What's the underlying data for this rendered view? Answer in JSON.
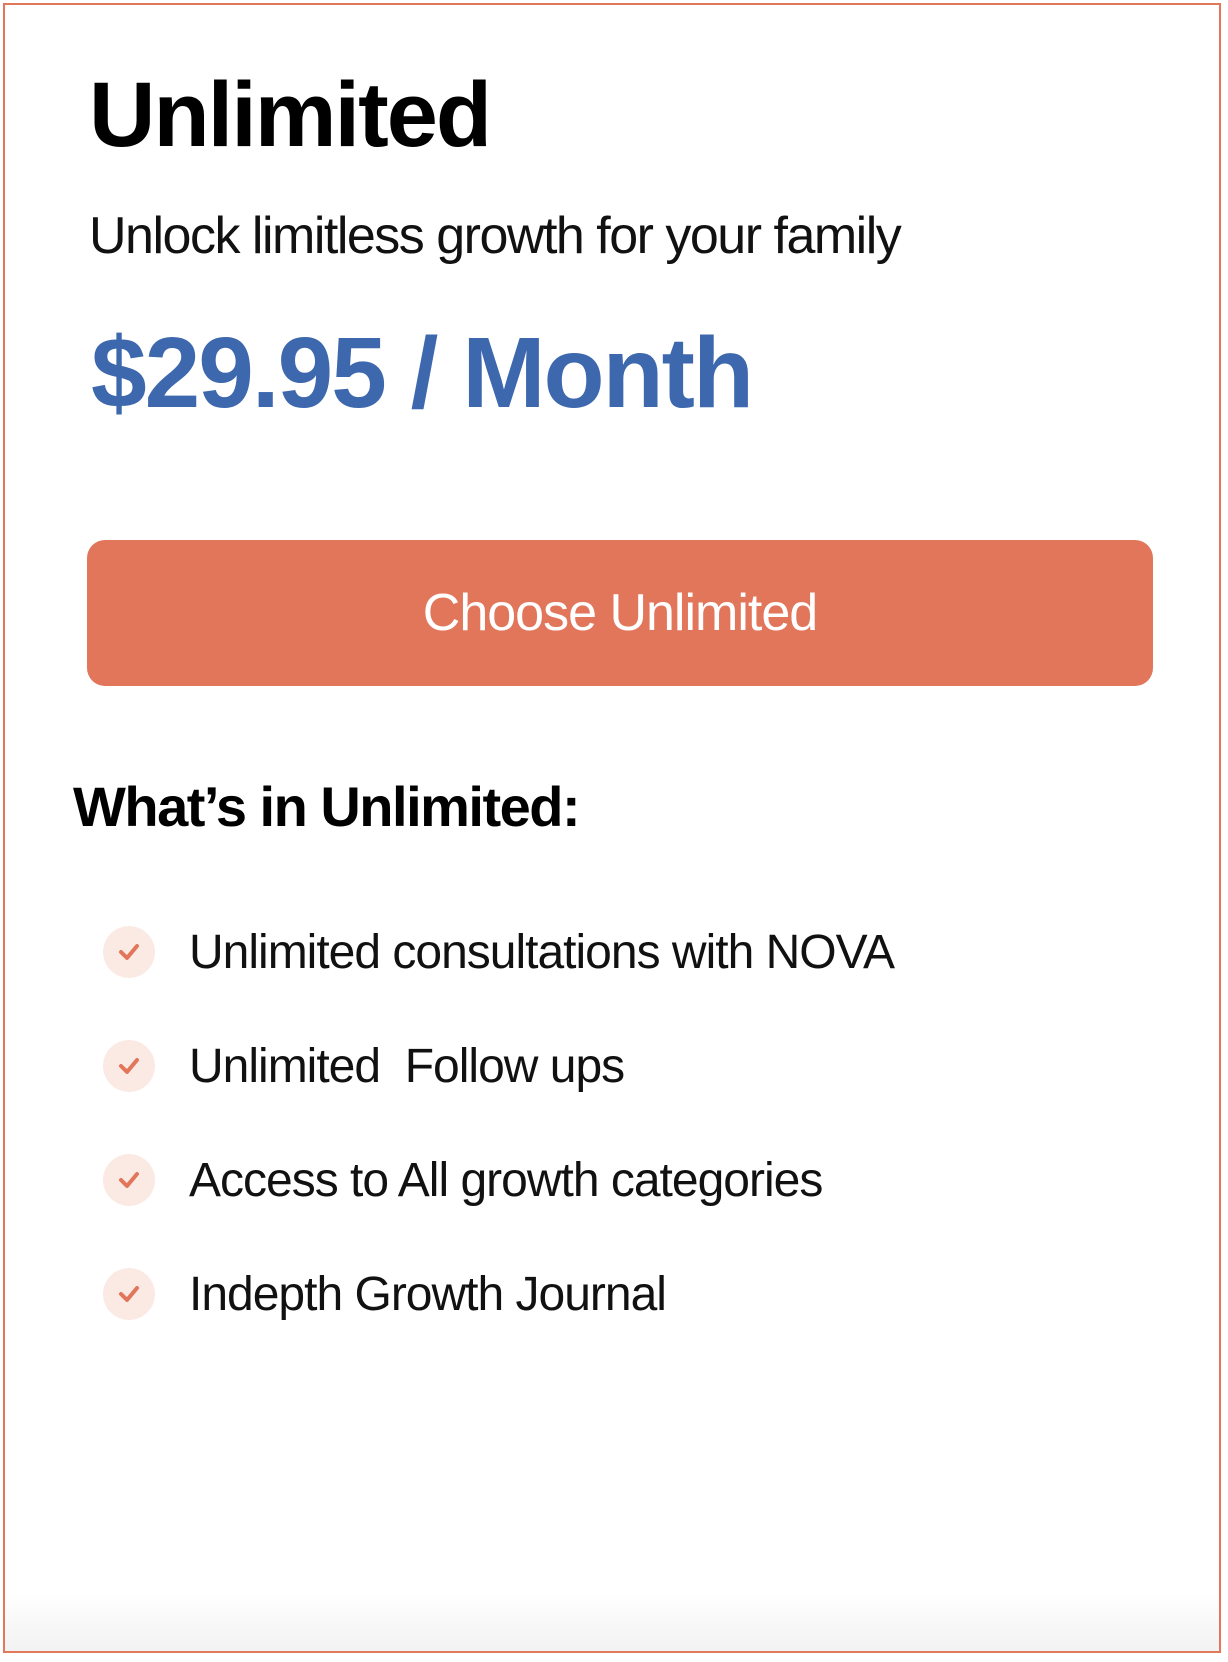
{
  "plan": {
    "title": "Unlimited",
    "subtitle": "Unlock limitless growth for your family",
    "price": "$29.95 / Month",
    "cta_label": "Choose Unlimited"
  },
  "features": {
    "heading": "What’s in Unlimited:",
    "items": [
      {
        "label": "Unlimited consultations with NOVA",
        "icon": "check-icon"
      },
      {
        "label": "Unlimited  Follow ups",
        "icon": "check-icon"
      },
      {
        "label": "Access to All growth categories",
        "icon": "check-icon"
      },
      {
        "label": "Indepth Growth Journal",
        "icon": "check-icon"
      }
    ]
  },
  "colors": {
    "accent": "#e2765b",
    "price": "#3d68ae",
    "border": "#e2785a",
    "check_bg": "#fbeae4"
  }
}
